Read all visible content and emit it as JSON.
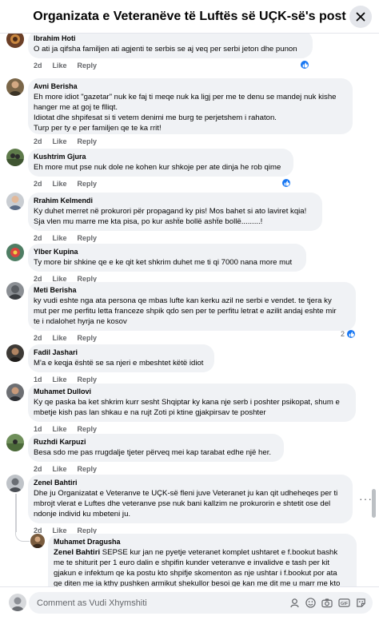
{
  "header": {
    "title": "Organizata e Veteranëve të Luftës së UÇK-së's post"
  },
  "comments": [
    {
      "author": "Ibrahim Hoti",
      "lines": [
        "O ati ja qifsha familjen ati agjenti te serbis se aj veq per serbi jeton dhe punon"
      ],
      "time": "2d",
      "like": "Like",
      "reply": "Reply",
      "reactions": ""
    },
    {
      "author": "Avni Berisha",
      "lines": [
        "Eh more idiot \"gazetar\" nuk ke faj ti meqe nuk ka ligj per me te denu se mandej nuk kishe",
        "hanger me at goj te flliqt.",
        "Idiotat dhe shpifesat si ti vetem denimi me burg te perjetshem i rahaton.",
        "Turp per ty e per familjen qe te ka rrit!"
      ],
      "time": "2d",
      "like": "Like",
      "reply": "Reply",
      "reactions": ""
    },
    {
      "author": "Kushtrim Gjura",
      "lines": [
        "Eh more mut pse nuk dole ne kohen kur shkoje per ate dinja he rob qime"
      ],
      "time": "2d",
      "like": "Like",
      "reply": "Reply",
      "reactions": ""
    },
    {
      "author": "Rrahim Kelmendi",
      "lines": [
        "Ky duhet merret në prokurori për propagand ky pis! Mos bahet si ato laviret kqia!",
        "Sja vlen mu marre me kta pisa, po kur ashẗe bollë ashẗe bollë.........!"
      ],
      "time": "2d",
      "like": "Like",
      "reply": "Reply",
      "reactions": ""
    },
    {
      "author": "Ylber Kupina",
      "lines": [
        "Ty more bir shkine qe e ke qit ket shkrim duhet me ti qi 7000 nana more mut"
      ],
      "time": "2d",
      "like": "Like",
      "reply": "Reply",
      "reactions": ""
    },
    {
      "author": "Meti Berisha",
      "lines": [
        "ky vudi eshte nga ata persona qe mbas lufte kan kerku azil ne serbi e vendet. te tjera ky",
        "mut per me perfitu letta franceze shpik qdo sen per te perfitu letrat e azilit andaj eshte mir",
        "te i ndalohet hyrja ne kosov"
      ],
      "time": "2d",
      "like": "Like",
      "reply": "Reply",
      "reactions": "2"
    },
    {
      "author": "Fadil Jashari",
      "lines": [
        "M'a e keqja është se sa njeri e mbeshtet këtë idiot"
      ],
      "time": "1d",
      "like": "Like",
      "reply": "Reply",
      "reactions": ""
    },
    {
      "author": "Muhamet Dullovi",
      "lines": [
        "Ky qe paska ba ket shkrim kurr sesht Shqiptar ky kana nje serb i poshter psikopat, shum e",
        "mbetje kish pas lan shkau e na rujt Zoti pi ktine gjakpirsav te poshter"
      ],
      "time": "1d",
      "like": "Like",
      "reply": "Reply",
      "reactions": ""
    },
    {
      "author": "Ruzhdi Karpuzi",
      "lines": [
        "Besa sdo me pas rrugdalje tjeter përveq mei kap tarabat edhe një her."
      ],
      "time": "2d",
      "like": "Like",
      "reply": "Reply",
      "reactions": ""
    },
    {
      "author": "Zenel Bahtiri",
      "lines": [
        "Dhe ju Organizatat e Veteranve te UÇK-së fleni juve Veteranet ju kan qit udheheqes per ti",
        "mbrojt vlerat e Luftes dhe veteranve pse nuk bani kallzim ne prokurorin e shtetit ose del",
        "ndonje individ ku mbeteni ju."
      ],
      "time": "2d",
      "like": "Like",
      "reply": "Reply",
      "reactions": ""
    }
  ],
  "reply": {
    "author": "Muhamet Dragusha",
    "mention": "Zenel Bahtiri",
    "lines": [
      "SEPSE kur jan ne pyetje veteranet komplet ushtaret e f.bookut bashk",
      "me te shiturit per 1 euro dalin e shpifin kunder veteranve e invalidve e tash per kit",
      "gjakun e infektum qe ka postu kto shpifje skomenton as nje ushtar i f.bookut por ata",
      "ge diten me ia kthy pushken armikut shekullor besoi ge kan me dit me u marr me kto"
    ]
  },
  "composer": {
    "placeholder": "Comment as Vudi Xhymshiti"
  }
}
